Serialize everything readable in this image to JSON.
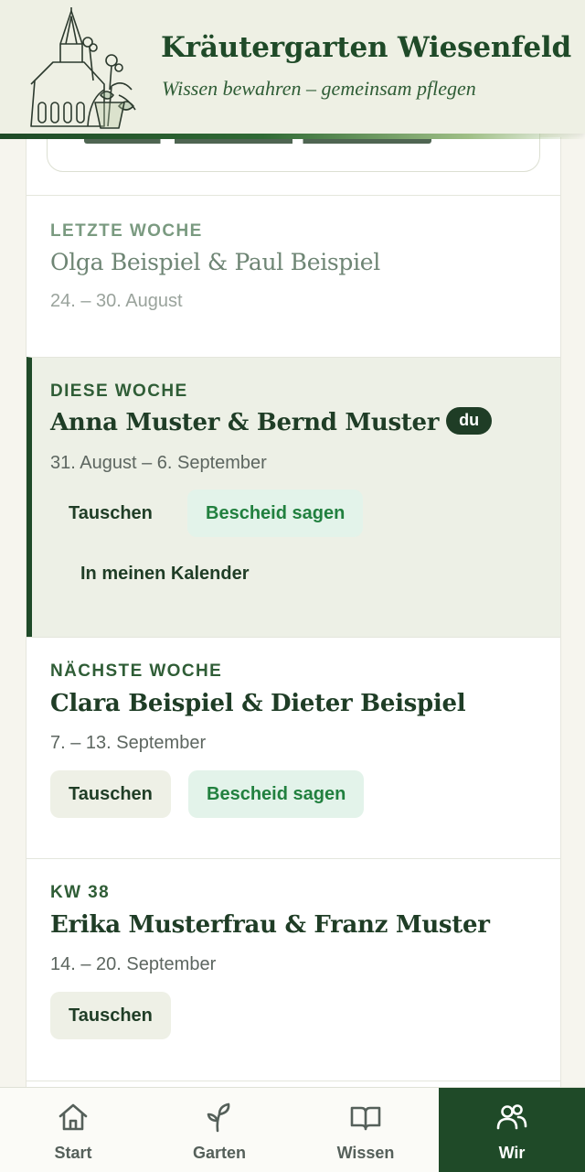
{
  "header": {
    "title": "Kräutergarten Wiesenfeld",
    "subtitle": "Wissen bewahren – gemeinsam pflegen"
  },
  "entries": [
    {
      "week_label": "LETZTE WOCHE",
      "names": "Olga Beispiel & Paul Beispiel",
      "dates": "24. – 30. August",
      "state": "past"
    },
    {
      "week_label": "DIESE WOCHE",
      "names": "Anna Muster & Bernd Muster",
      "badge": "du",
      "dates": "31. August – 6. September",
      "state": "current",
      "actions": {
        "swap": "Tauschen",
        "notify": "Bescheid sagen",
        "calendar": "In meinen Kalender"
      }
    },
    {
      "week_label": "NÄCHSTE WOCHE",
      "names": "Clara Beispiel & Dieter Beispiel",
      "dates": "7. – 13. September",
      "state": "upcoming",
      "actions": {
        "swap": "Tauschen",
        "notify": "Bescheid sagen"
      }
    },
    {
      "week_label": "KW 38",
      "names": "Erika Musterfrau & Franz Muster",
      "dates": "14. – 20. September",
      "state": "upcoming",
      "actions": {
        "swap": "Tauschen"
      }
    }
  ],
  "nav": [
    {
      "label": "Start",
      "icon": "home-icon"
    },
    {
      "label": "Garten",
      "icon": "sprout-icon"
    },
    {
      "label": "Wissen",
      "icon": "book-icon"
    },
    {
      "label": "Wir",
      "icon": "people-icon",
      "active": true
    }
  ],
  "colors": {
    "primary": "#1f4a28",
    "accent_green": "#21803f",
    "current_bg": "#edf0e6",
    "header_bg": "#eef0e4"
  }
}
